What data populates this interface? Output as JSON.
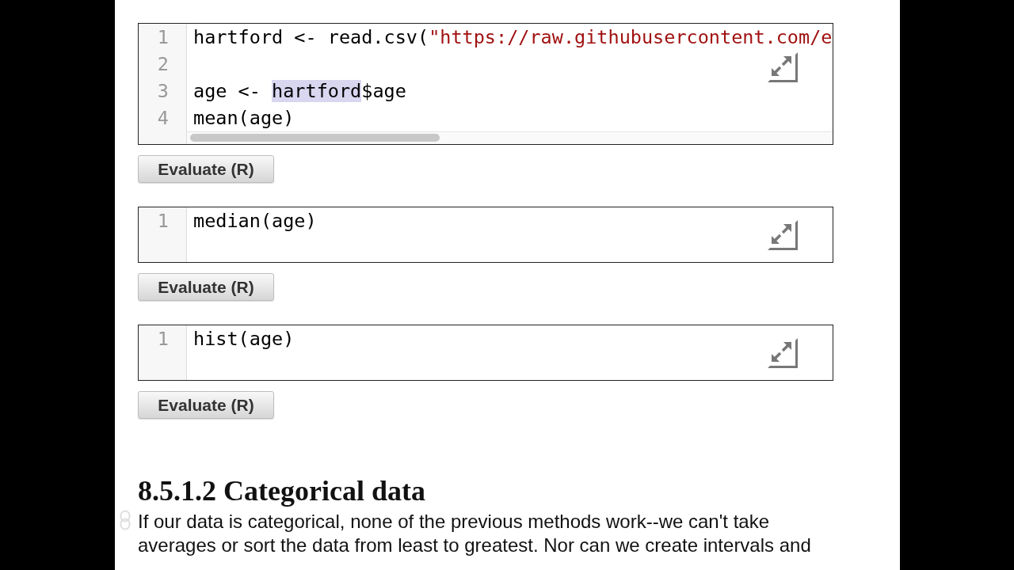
{
  "code_cells": [
    {
      "lines": [
        {
          "number": "1",
          "tokens": [
            {
              "kind": "plain",
              "text": "hartford <- read.csv("
            },
            {
              "kind": "string",
              "text": "\"https://raw.githubusercontent.com/e"
            }
          ]
        },
        {
          "number": "2"
        },
        {
          "number": "3",
          "tokens": [
            {
              "kind": "plain",
              "text": "age <- "
            },
            {
              "kind": "highlight",
              "text": "hartford"
            },
            {
              "kind": "plain",
              "text": "$age"
            }
          ]
        },
        {
          "number": "4",
          "tokens": [
            {
              "kind": "plain",
              "text": "mean(age)"
            }
          ]
        }
      ],
      "horizontal_scrollbar": true,
      "button": "Evaluate (R)"
    },
    {
      "lines": [
        {
          "number": "1",
          "tokens": [
            {
              "kind": "plain",
              "text": "median(age)"
            }
          ]
        }
      ],
      "horizontal_scrollbar": false,
      "button": "Evaluate (R)"
    },
    {
      "lines": [
        {
          "number": "1",
          "tokens": [
            {
              "kind": "plain",
              "text": "hist(age)"
            }
          ]
        }
      ],
      "horizontal_scrollbar": false,
      "button": "Evaluate (R)"
    }
  ],
  "section": {
    "heading": "8.5.1.2 Categorical data",
    "paragraph": "If our data is categorical, none of the previous methods work--we can't take averages or sort the data from least to greatest. Nor can we create intervals and"
  }
}
